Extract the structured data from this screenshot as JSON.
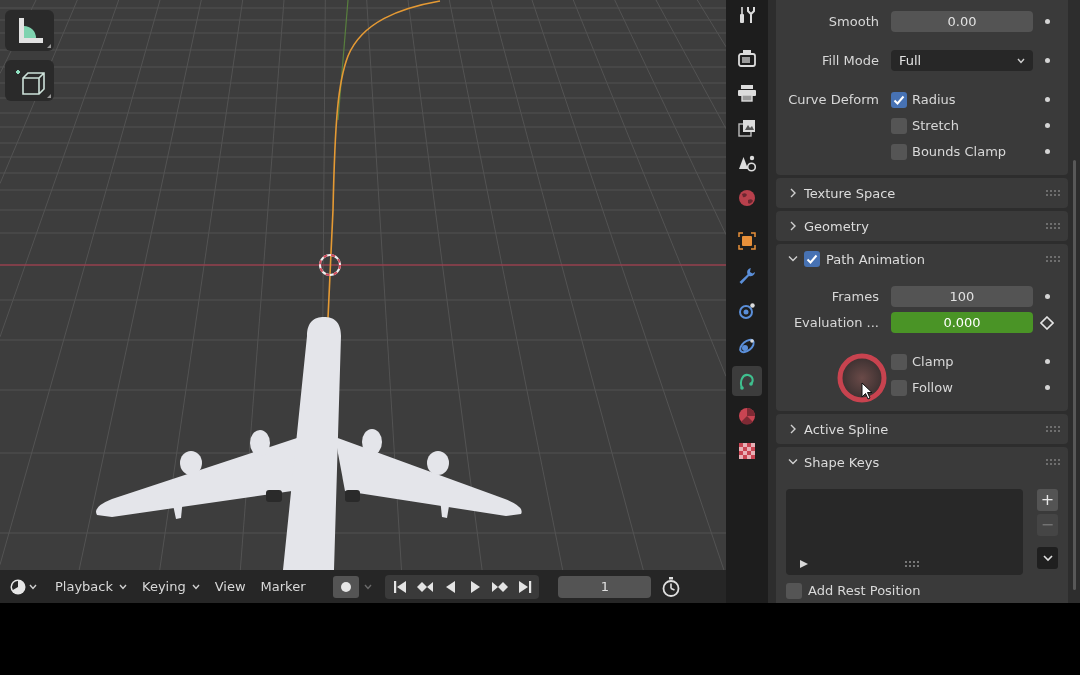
{
  "timeline": {
    "menus": [
      {
        "label": "Playback",
        "dropdown": true
      },
      {
        "label": "Keying",
        "dropdown": true
      },
      {
        "label": "View",
        "dropdown": false
      },
      {
        "label": "Marker",
        "dropdown": false
      }
    ],
    "auto_keying": false,
    "current_frame": "1"
  },
  "properties": {
    "tab_groups": [
      [
        {
          "kind": "tool",
          "selected": false
        }
      ],
      [
        {
          "kind": "render",
          "selected": false
        },
        {
          "kind": "output",
          "selected": false
        },
        {
          "kind": "view_layer",
          "selected": false
        },
        {
          "kind": "scene",
          "selected": false
        },
        {
          "kind": "world",
          "selected": false
        }
      ],
      [
        {
          "kind": "object",
          "selected": false
        },
        {
          "kind": "modifiers",
          "selected": false
        },
        {
          "kind": "particles",
          "selected": false
        },
        {
          "kind": "physics",
          "selected": false
        },
        {
          "kind": "data",
          "selected": true
        },
        {
          "kind": "material",
          "selected": false
        },
        {
          "kind": "texture",
          "selected": false
        }
      ]
    ],
    "panels": [
      {
        "rows": [
          {
            "kind": "number",
            "label": "Smooth",
            "value": "0.00",
            "animated": false
          },
          {
            "kind": "dropdown",
            "label": "Fill Mode",
            "value": "Full"
          },
          {
            "kind": "checkbox",
            "label": "Curve Deform",
            "text": "Radius",
            "checked": true
          },
          {
            "kind": "checkbox",
            "text": "Stretch",
            "checked": false
          },
          {
            "kind": "checkbox",
            "text": "Bounds Clamp",
            "checked": false
          }
        ]
      },
      {
        "title": "Texture Space",
        "expanded": false
      },
      {
        "title": "Geometry",
        "expanded": false
      },
      {
        "title": "Path Animation",
        "expanded": true,
        "checked": true,
        "rows": [
          {
            "kind": "number",
            "label": "Frames",
            "value": "100",
            "animated": false
          },
          {
            "kind": "number",
            "label": "Evaluation ...",
            "value": "0.000",
            "animated": true
          },
          {
            "kind": "checkbox",
            "text": "Clamp",
            "checked": false
          },
          {
            "kind": "checkbox",
            "text": "Follow",
            "checked": false
          }
        ]
      },
      {
        "title": "Active Spline",
        "expanded": false
      },
      {
        "title": "Shape Keys",
        "expanded": true,
        "list": {
          "buttons": [
            {
              "label": "+",
              "disabled": false
            },
            {
              "label": "−",
              "disabled": true
            }
          ]
        },
        "rows": [
          {
            "kind": "wide_checkbox",
            "text": "Add Rest Position",
            "checked": false
          }
        ]
      }
    ]
  }
}
